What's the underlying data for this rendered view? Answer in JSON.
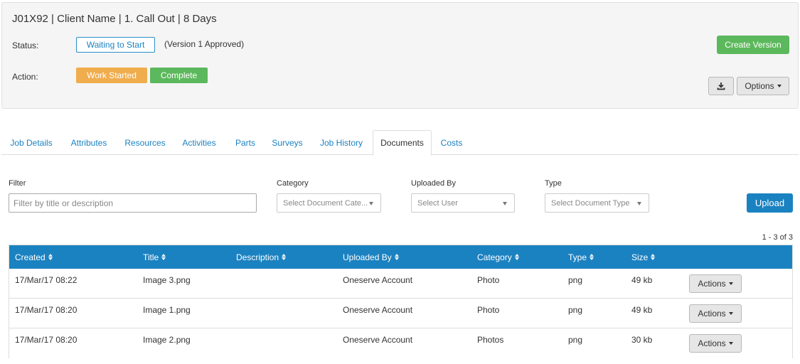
{
  "header": {
    "title": "J01X92 | Client Name | 1. Call Out | 8 Days",
    "status_label": "Status:",
    "status_value": "Waiting to Start",
    "version_note": "(Version 1 Approved)",
    "action_label": "Action:",
    "work_started_label": "Work Started",
    "complete_label": "Complete",
    "create_version_label": "Create Version",
    "options_label": "Options"
  },
  "tabs": [
    {
      "label": "Job Details"
    },
    {
      "label": "Attributes"
    },
    {
      "label": "Resources"
    },
    {
      "label": "Activities"
    },
    {
      "label": "Parts"
    },
    {
      "label": "Surveys"
    },
    {
      "label": "Job History"
    },
    {
      "label": "Documents",
      "active": true
    },
    {
      "label": "Costs"
    }
  ],
  "filters": {
    "filter_label": "Filter",
    "filter_placeholder": "Filter by title or description",
    "category_label": "Category",
    "category_placeholder": "Select Document Cate...",
    "uploaded_by_label": "Uploaded By",
    "uploaded_by_placeholder": "Select User",
    "type_label": "Type",
    "type_placeholder": "Select Document Type",
    "upload_label": "Upload"
  },
  "pager": "1 - 3 of 3",
  "table": {
    "columns": [
      "Created",
      "Title",
      "Description",
      "Uploaded By",
      "Category",
      "Type",
      "Size"
    ],
    "actions_label": "Actions",
    "rows": [
      {
        "created": "17/Mar/17 08:22",
        "title": "Image 3.png",
        "description": "",
        "uploaded_by": "Oneserve Account",
        "category": "Photo",
        "type": "png",
        "size": "49 kb"
      },
      {
        "created": "17/Mar/17 08:20",
        "title": "Image 1.png",
        "description": "",
        "uploaded_by": "Oneserve Account",
        "category": "Photo",
        "type": "png",
        "size": "49 kb"
      },
      {
        "created": "17/Mar/17 08:20",
        "title": "Image 2.png",
        "description": "",
        "uploaded_by": "Oneserve Account",
        "category": "Photos",
        "type": "png",
        "size": "30 kb"
      }
    ]
  },
  "colors": {
    "primary": "#1b82c1",
    "success": "#5cb85c",
    "warning": "#f0ad4e"
  }
}
